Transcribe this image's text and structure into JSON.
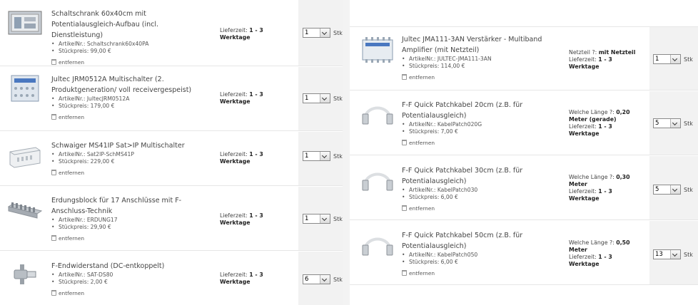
{
  "labels": {
    "article_prefix": "ArtikelNr.: ",
    "price_prefix": "Stückpreis: ",
    "remove": "entfernen",
    "lieferzeit": "Lieferzeit: ",
    "werktage": "Werktage",
    "unit": "Stk",
    "netzteil_label": "Netzteil ?: ",
    "length_label": "Welche Länge ?: "
  },
  "left_items": [
    {
      "title": "Schaltschrank 60x40cm mit Potentialausgleich-Aufbau (incl. Dienstleistung)",
      "article": "Schaltschrank60x40PA",
      "price": "99,00 €",
      "delivery": "1 - 3",
      "qty": "1",
      "icon": "cabinet-image"
    },
    {
      "title": "Jultec JRM0512A Multischalter (2. Produktgeneration/ voll receivergespeist)",
      "article": "JultecJRM0512A",
      "price": "179,00 €",
      "delivery": "1 - 3",
      "qty": "1",
      "icon": "multiswitch-image"
    },
    {
      "title": "Schwaiger MS41IP Sat>IP Multischalter",
      "article": "Sat2IP-SchMS41P",
      "price": "229,00 €",
      "delivery": "1 - 3",
      "qty": "1",
      "icon": "satip-switch-image"
    },
    {
      "title": "Erdungsblock für 17 Anschlüsse mit F-Anschluss-Technik",
      "article": "ERDUNG17",
      "price": "29,90 €",
      "delivery": "1 - 3",
      "qty": "1",
      "icon": "grounding-block-image"
    },
    {
      "title": "F-Endwiderstand (DC-entkoppelt)",
      "article": "SAT-DS80",
      "price": "2,00 €",
      "delivery": "1 - 3",
      "qty": "6",
      "icon": "terminator-image"
    }
  ],
  "right_items": [
    {
      "title": "Jultec JMA111-3AN Verstärker - Multiband Amplifier (mit Netzteil)",
      "article": "JULTEC-JMA111-3AN",
      "price": "114,00 €",
      "option_value": "mit Netzteil",
      "delivery": "1 - 3",
      "qty": "1",
      "icon": "amplifier-image"
    },
    {
      "title": "F-F Quick Patchkabel 20cm (z.B. für Potentialausgleich)",
      "article": "KabelPatch020G",
      "price": "7,00 €",
      "option_value": "0,20 Meter (gerade)",
      "delivery": "1 - 3",
      "qty": "5",
      "icon": "patch-cable-image"
    },
    {
      "title": "F-F Quick Patchkabel 30cm (z.B. für Potentialausgleich)",
      "article": "KabelPatch030",
      "price": "6,00 €",
      "option_value": "0,30 Meter",
      "delivery": "1 - 3",
      "qty": "5",
      "icon": "patch-cable-image"
    },
    {
      "title": "F-F Quick Patchkabel 50cm (z.B. für Potentialausgleich)",
      "article": "KabelPatch050",
      "price": "6,00 €",
      "option_value": "0,50 Meter",
      "delivery": "1 - 3",
      "qty": "13",
      "icon": "patch-cable-image"
    }
  ]
}
